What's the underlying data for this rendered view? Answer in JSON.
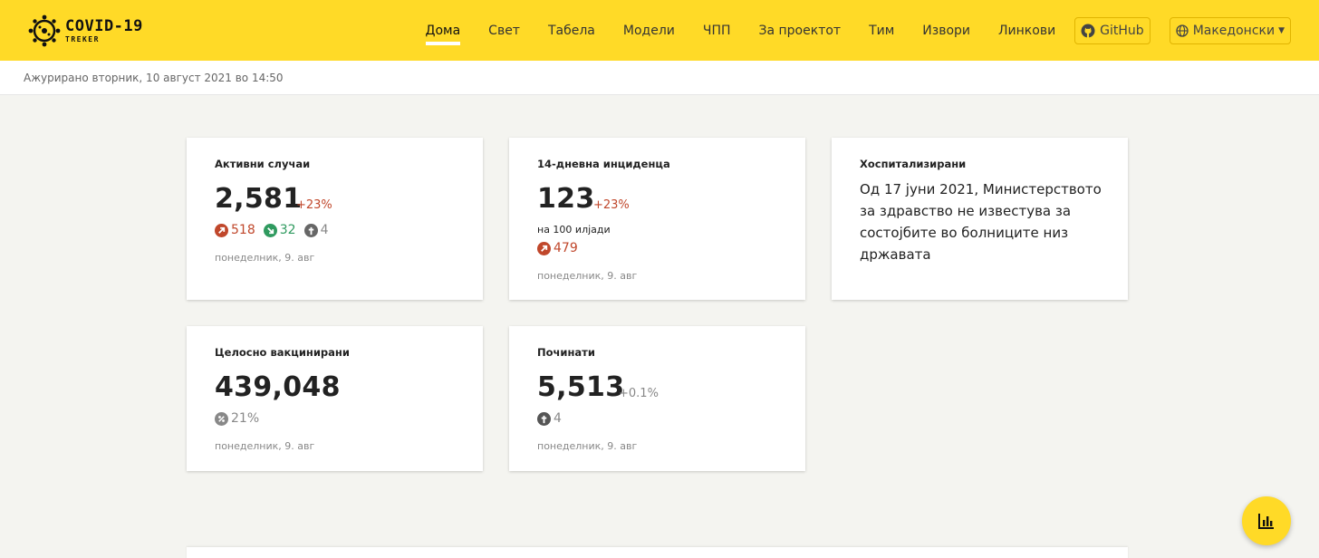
{
  "logo": {
    "title": "COVID-19",
    "subtitle": "TREKER"
  },
  "nav": {
    "items": [
      "Дома",
      "Свет",
      "Табела",
      "Модели",
      "ЧПП",
      "За проектот",
      "Тим",
      "Извори",
      "Линкови"
    ],
    "active": "Дома",
    "github_label": "GitHub",
    "language_label": "Македонски"
  },
  "updated": "Ажурирано вторник, 10 август 2021 во 14:50",
  "cards": {
    "active": {
      "title": "Активни случаи",
      "value": "2,581",
      "change": "+23%",
      "new": "518",
      "recovered": "32",
      "deceased": "4",
      "date": "понеделник, 9. авг"
    },
    "incidence": {
      "title": "14-дневна инциденца",
      "value": "123",
      "change": "+23%",
      "note": "на 100 илјади",
      "new": "479",
      "date": "понеделник, 9. авг"
    },
    "hospitalized": {
      "title": "Хоспитализирани",
      "text": "Од 17 јуни 2021, Министерството за здравство не известува за состојбите во болниците низ државата"
    },
    "vaccinated": {
      "title": "Целосно вакцинирани",
      "value": "439,048",
      "percent": "21%",
      "date": "понеделник, 9. авг"
    },
    "deceased": {
      "title": "Починати",
      "value": "5,513",
      "change": "+0.1%",
      "new": "4",
      "date": "понеделник, 9. авг"
    }
  },
  "colors": {
    "accent": "#ffda27",
    "increase": "#c0472b",
    "decrease": "#2f9a5f",
    "neutral": "#666666"
  }
}
